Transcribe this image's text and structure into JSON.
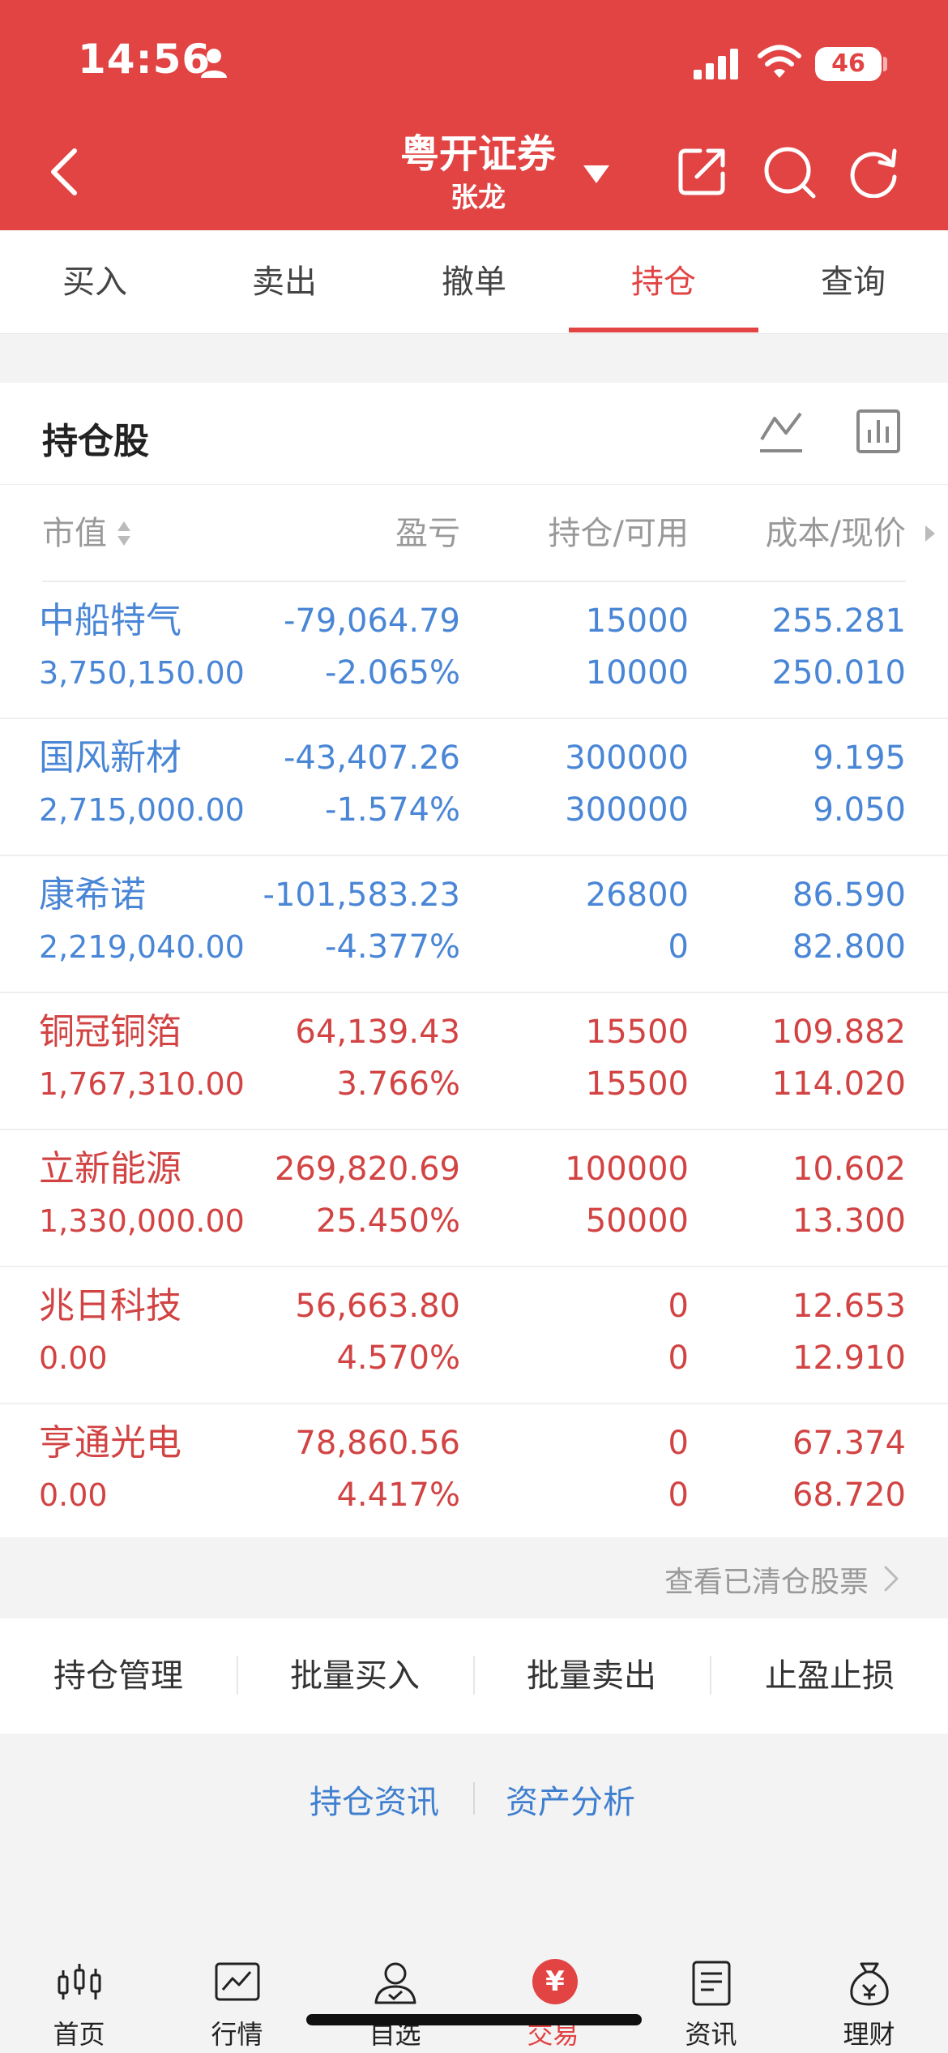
{
  "status_bar": {
    "time": "14:56",
    "battery": "46"
  },
  "header": {
    "title": "粤开证券",
    "subtitle": "张龙"
  },
  "tabs": [
    {
      "label": "买入",
      "active": false
    },
    {
      "label": "卖出",
      "active": false
    },
    {
      "label": "撤单",
      "active": false
    },
    {
      "label": "持仓",
      "active": true
    },
    {
      "label": "查询",
      "active": false
    }
  ],
  "holdings": {
    "title": "持仓股",
    "columns": [
      "市值",
      "盈亏",
      "持仓/可用",
      "成本/现价"
    ],
    "rows": [
      {
        "name": "中船特气",
        "market_value": "3,750,150.00",
        "profit_loss": "-79,064.79",
        "profit_loss_pct": "-2.065%",
        "position": "15000",
        "available": "10000",
        "cost": "255.281",
        "price": "250.010",
        "trend": "down"
      },
      {
        "name": "国风新材",
        "market_value": "2,715,000.00",
        "profit_loss": "-43,407.26",
        "profit_loss_pct": "-1.574%",
        "position": "300000",
        "available": "300000",
        "cost": "9.195",
        "price": "9.050",
        "trend": "down"
      },
      {
        "name": "康希诺",
        "market_value": "2,219,040.00",
        "profit_loss": "-101,583.23",
        "profit_loss_pct": "-4.377%",
        "position": "26800",
        "available": "0",
        "cost": "86.590",
        "price": "82.800",
        "trend": "down"
      },
      {
        "name": "铜冠铜箔",
        "market_value": "1,767,310.00",
        "profit_loss": "64,139.43",
        "profit_loss_pct": "3.766%",
        "position": "15500",
        "available": "15500",
        "cost": "109.882",
        "price": "114.020",
        "trend": "up"
      },
      {
        "name": "立新能源",
        "market_value": "1,330,000.00",
        "profit_loss": "269,820.69",
        "profit_loss_pct": "25.450%",
        "position": "100000",
        "available": "50000",
        "cost": "10.602",
        "price": "13.300",
        "trend": "up"
      },
      {
        "name": "兆日科技",
        "market_value": "0.00",
        "profit_loss": "56,663.80",
        "profit_loss_pct": "4.570%",
        "position": "0",
        "available": "0",
        "cost": "12.653",
        "price": "12.910",
        "trend": "up"
      },
      {
        "name": "亨通光电",
        "market_value": "0.00",
        "profit_loss": "78,860.56",
        "profit_loss_pct": "4.417%",
        "position": "0",
        "available": "0",
        "cost": "67.374",
        "price": "68.720",
        "trend": "up"
      }
    ]
  },
  "view_cleared": "查看已清仓股票",
  "actions": [
    "持仓管理",
    "批量买入",
    "批量卖出",
    "止盈止损"
  ],
  "links": [
    "持仓资讯",
    "资产分析"
  ],
  "bottom_nav": [
    {
      "label": "首页",
      "icon": "home-candlestick-icon"
    },
    {
      "label": "行情",
      "icon": "market-chart-icon"
    },
    {
      "label": "自选",
      "icon": "watchlist-user-icon"
    },
    {
      "label": "交易",
      "icon": "trade-yuan-icon",
      "badge": "¥",
      "active": true
    },
    {
      "label": "资讯",
      "icon": "news-document-icon"
    },
    {
      "label": "理财",
      "icon": "wealth-bag-icon"
    }
  ],
  "colors": {
    "brand_red": "#e24343",
    "down_blue": "#4a86d6",
    "up_red": "#d24343",
    "link_blue": "#3f7fcf"
  }
}
